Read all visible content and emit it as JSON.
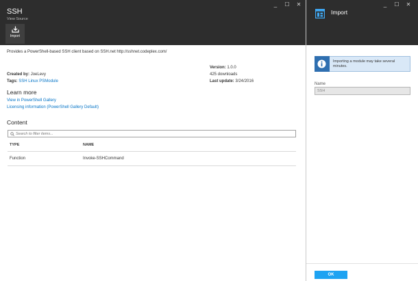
{
  "left_blade": {
    "title": "SSH",
    "subtitle": "View Source",
    "window_controls": [
      "_",
      "☐",
      "✕"
    ],
    "toolbar": {
      "import_label": "Import"
    },
    "description": "Provides a PowerShell-based SSH client based on SSH.net http://sshnet.codeplex.com/",
    "created_by_key": "Created by:",
    "created_by_value": "JoeLevy",
    "tags_key": "Tags:",
    "tags_value": "SSH Linux PSModule",
    "version_key": "Version:",
    "version_value": "1.0.0",
    "downloads": "425 downloads",
    "last_update_key": "Last update:",
    "last_update_value": "3/24/2016",
    "learn_more_title": "Learn more",
    "learn_links": [
      "View in PowerShell Gallery",
      "Licensing information (PowerShell Gallery Default)"
    ],
    "content_title": "Content",
    "search_placeholder": "Search to filter items...",
    "table": {
      "headers": [
        "TYPE",
        "NAME"
      ],
      "rows": [
        [
          "Function",
          "Invoke-SSHCommand"
        ]
      ]
    }
  },
  "right_blade": {
    "title": "Import",
    "window_controls": [
      "_",
      "☐",
      "✕"
    ],
    "info_text": "Importing a module may take several minutes.",
    "name_label": "Name",
    "name_value": "SSH",
    "ok_label": "OK"
  },
  "colors": {
    "header_bg": "#2d2d2d",
    "link": "#0072c6",
    "ok_button": "#1ea3f2",
    "info_bg": "#d9e8f7",
    "info_icon_bg": "#2f6fb0"
  },
  "icons": {
    "import": "download-tray-icon",
    "blade": "blade-window-icon",
    "info": "info-icon",
    "search": "search-icon"
  }
}
